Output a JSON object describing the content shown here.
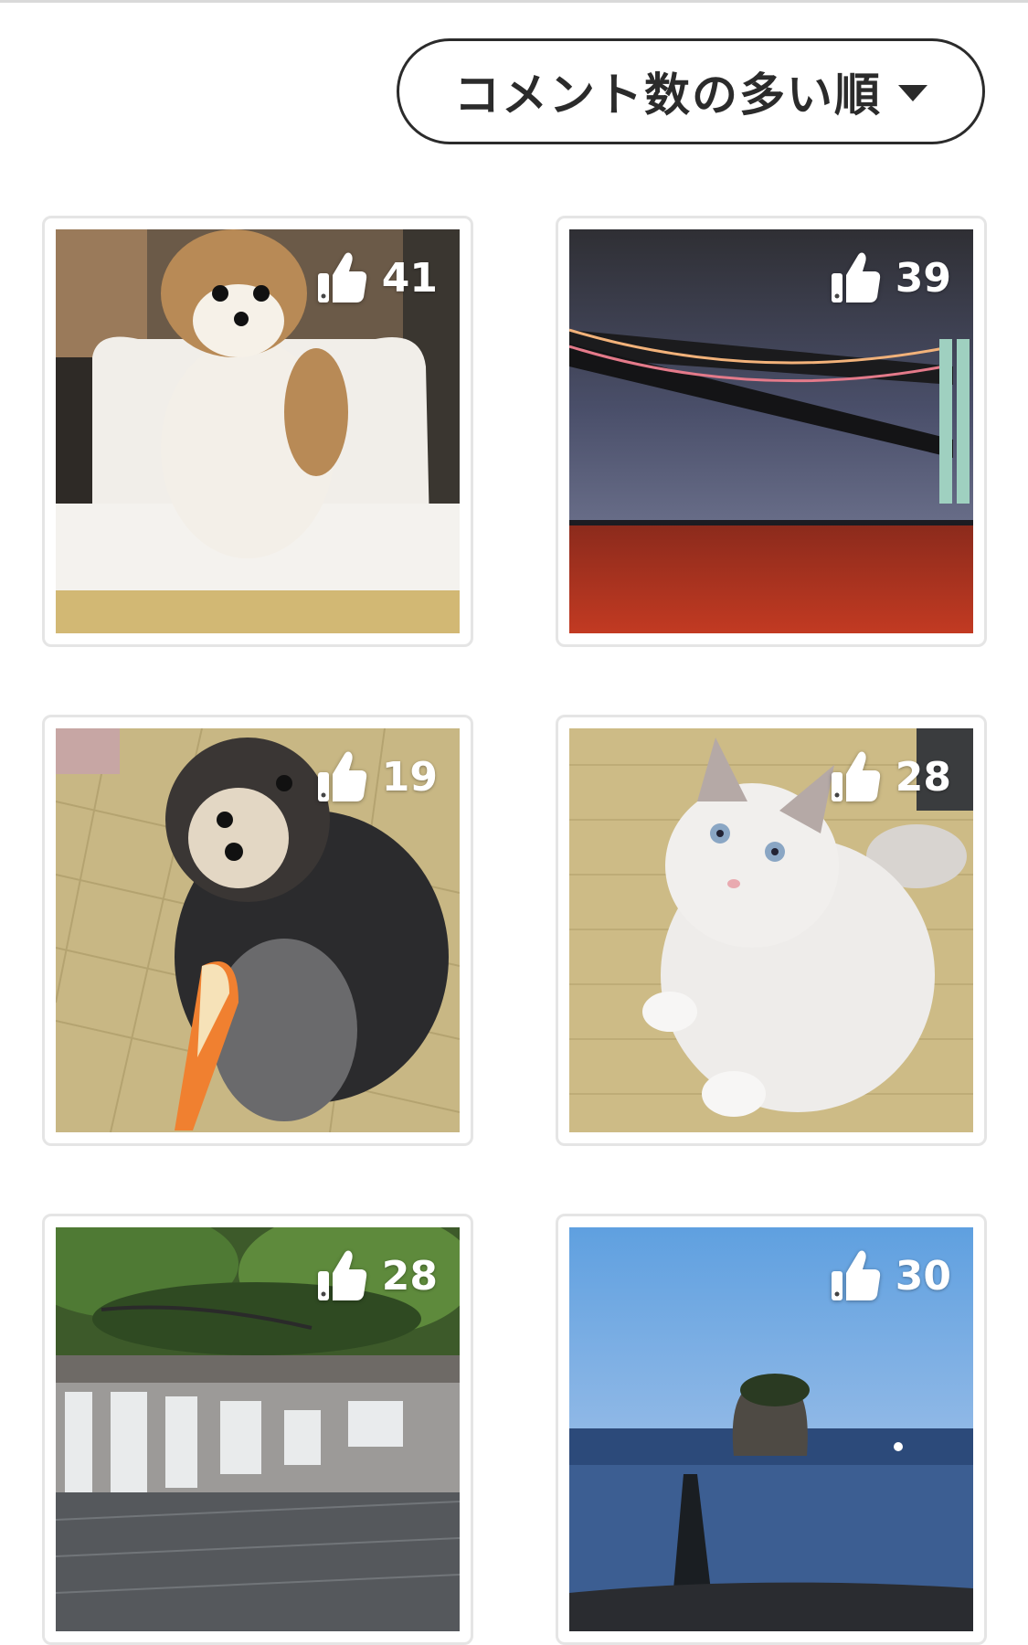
{
  "sort": {
    "label": "コメント数の多い順"
  },
  "posts": [
    {
      "likes": "41",
      "subject": "dog"
    },
    {
      "likes": "39",
      "subject": "bridge"
    },
    {
      "likes": "19",
      "subject": "dog"
    },
    {
      "likes": "28",
      "subject": "cat"
    },
    {
      "likes": "28",
      "subject": "waterfall"
    },
    {
      "likes": "30",
      "subject": "sea-rock"
    }
  ],
  "icons": {
    "sort": "caret-down-icon",
    "like": "thumbs-up-icon"
  }
}
